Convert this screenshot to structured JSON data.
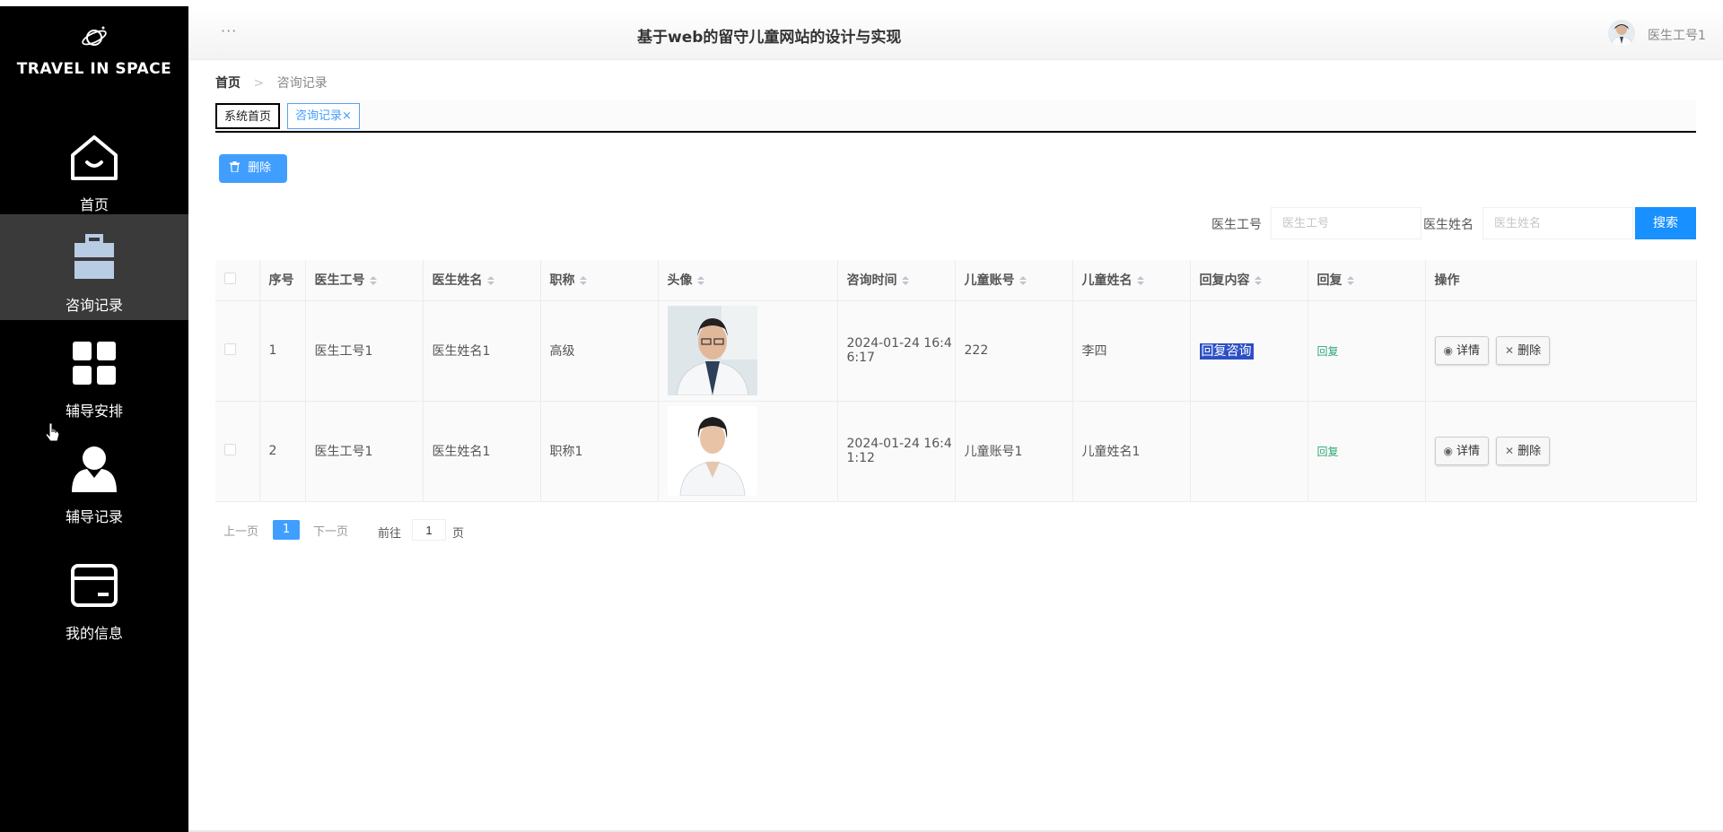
{
  "brand": {
    "name": "TRAVEL IN SPACE"
  },
  "sidebar": {
    "items": [
      {
        "label": "首页",
        "icon": "home-icon",
        "active": false
      },
      {
        "label": "咨询记录",
        "icon": "briefcase-icon",
        "active": true
      },
      {
        "label": "辅导安排",
        "icon": "grid-icon",
        "active": false
      },
      {
        "label": "辅导记录",
        "icon": "user-icon",
        "active": false
      },
      {
        "label": "我的信息",
        "icon": "card-icon",
        "active": false
      }
    ]
  },
  "header": {
    "more": "···",
    "title": "基于web的留守儿童网站的设计与实现",
    "username": "医生工号1"
  },
  "breadcrumb": {
    "home": "首页",
    "separator": ">",
    "current": "咨询记录"
  },
  "tabs": [
    {
      "label": "系统首页"
    },
    {
      "label": "咨询记录",
      "close": "×"
    }
  ],
  "toolbar": {
    "delete_label": "删除",
    "delete_icon": "trash-icon"
  },
  "search": {
    "doctor_id_label": "医生工号",
    "doctor_id_placeholder": "医生工号",
    "doctor_name_label": "医生姓名",
    "doctor_name_placeholder": "医生姓名",
    "button": "搜索"
  },
  "table": {
    "columns": [
      "序号",
      "医生工号",
      "医生姓名",
      "职称",
      "头像",
      "咨询时间",
      "儿童账号",
      "儿童姓名",
      "回复内容",
      "回复",
      "操作"
    ],
    "rows": [
      {
        "index": "1",
        "doctor_id": "医生工号1",
        "doctor_name": "医生姓名1",
        "title": "高级",
        "time_line1": "2024-01-24 16:4",
        "time_line2": "6:17",
        "child_account": "222",
        "child_name": "李四",
        "reply_content": "回复咨询",
        "reply": "回复",
        "detail_btn": "详情",
        "delete_btn": "删除"
      },
      {
        "index": "2",
        "doctor_id": "医生工号1",
        "doctor_name": "医生姓名1",
        "title": "职称1",
        "time_line1": "2024-01-24 16:4",
        "time_line2": "1:12",
        "child_account": "儿童账号1",
        "child_name": "儿童姓名1",
        "reply_content": "",
        "reply": "回复",
        "detail_btn": "详情",
        "delete_btn": "删除"
      }
    ]
  },
  "pagination": {
    "prev": "上一页",
    "current": "1",
    "next": "下一页",
    "goto_label": "前往",
    "goto_value": "1",
    "page_suffix": "页"
  },
  "colors": {
    "sidebar_bg": "#000000",
    "sidebar_active": "#3a3a3a",
    "primary": "#409eff",
    "search_button": "#1890ff",
    "reply_link": "#2aa872",
    "highlight": "#2c4fc4"
  }
}
